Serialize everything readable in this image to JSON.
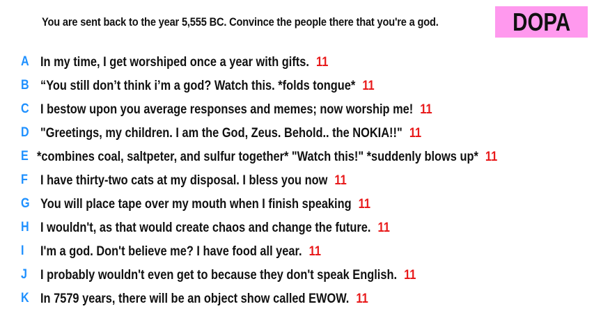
{
  "prompt": "You are sent back to the year 5,555 BC. Convince the people there that you're a god.",
  "badge": {
    "label": "DOPA",
    "color": "#ff99ee"
  },
  "colors": {
    "letter": "#1e90ff",
    "score": "#e8191a"
  },
  "responses": [
    {
      "letter": "A",
      "text": "In my time, I get worshiped once a year with gifts.",
      "score": "11"
    },
    {
      "letter": "B",
      "text": "“You still don’t think i’m a god? Watch this.  *folds tongue*",
      "score": "11"
    },
    {
      "letter": "C",
      "text": "I bestow upon you average responses and memes; now worship me!",
      "score": "11"
    },
    {
      "letter": "D",
      "text": "\"Greetings, my children. I am the God, Zeus. Behold.. the NOKIA!!\"",
      "score": "11"
    },
    {
      "letter": "E",
      "text": "*combines coal, saltpeter, and sulfur together* \"Watch this!\" *suddenly blows up*",
      "score": "11"
    },
    {
      "letter": "F",
      "text": "I have thirty-two cats at my disposal. I bless you now",
      "score": "11"
    },
    {
      "letter": "G",
      "text": "You will place tape over my mouth when I finish speaking",
      "score": "11"
    },
    {
      "letter": "H",
      "text": "I wouldn't, as that would create chaos and change the future.",
      "score": "11"
    },
    {
      "letter": "I",
      "text": "I'm a god. Don't believe me? I have food all year.",
      "score": "11"
    },
    {
      "letter": "J",
      "text": "I probably wouldn't even get to because they don't speak English.",
      "score": "11"
    },
    {
      "letter": "K",
      "text": "In 7579 years, there will be an object show called EWOW.",
      "score": "11"
    }
  ]
}
